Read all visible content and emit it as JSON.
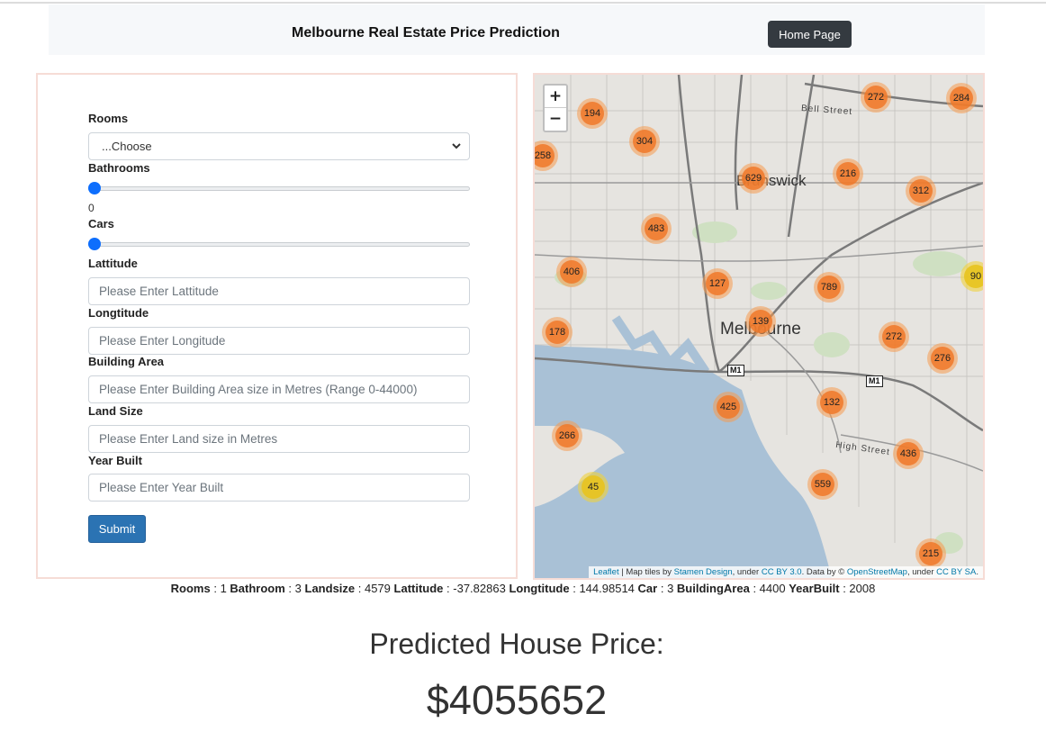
{
  "header": {
    "title": "Melbourne Real Estate Price Prediction",
    "home_button": "Home Page"
  },
  "form": {
    "rooms": {
      "label": "Rooms",
      "selected": "...Choose"
    },
    "bathrooms": {
      "label": "Bathrooms",
      "value": "0"
    },
    "cars": {
      "label": "Cars"
    },
    "latitude": {
      "label": "Lattitude",
      "placeholder": "Please Enter Lattitude"
    },
    "longitude": {
      "label": "Longtitude",
      "placeholder": "Please Enter Longitude"
    },
    "building_area": {
      "label": "Building Area",
      "placeholder": "Please Enter Building Area size in Metres  (Range 0-44000)"
    },
    "land_size": {
      "label": "Land Size",
      "placeholder": "Please Enter Land size in Metres"
    },
    "year_built": {
      "label": "Year Built",
      "placeholder": "Please Enter Year Built"
    },
    "submit": "Submit"
  },
  "map": {
    "zoom_in": "+",
    "zoom_out": "−",
    "place_labels": {
      "brunswick": "Brunswick",
      "melbourne": "Melbourne",
      "bell_street": "Bell Street",
      "high_street": "High Street"
    },
    "road_shields": {
      "m1_west": "M1",
      "m1_east": "M1"
    },
    "clusters": [
      {
        "count": "194",
        "color": "orange"
      },
      {
        "count": "304",
        "color": "orange"
      },
      {
        "count": "258",
        "color": "orange"
      },
      {
        "count": "272",
        "color": "orange"
      },
      {
        "count": "284",
        "color": "orange"
      },
      {
        "count": "629",
        "color": "orange"
      },
      {
        "count": "216",
        "color": "orange"
      },
      {
        "count": "312",
        "color": "orange"
      },
      {
        "count": "483",
        "color": "orange"
      },
      {
        "count": "406",
        "color": "orange"
      },
      {
        "count": "127",
        "color": "orange"
      },
      {
        "count": "789",
        "color": "orange"
      },
      {
        "count": "90",
        "color": "yellow"
      },
      {
        "count": "139",
        "color": "orange"
      },
      {
        "count": "178",
        "color": "orange"
      },
      {
        "count": "272",
        "color": "orange"
      },
      {
        "count": "276",
        "color": "orange"
      },
      {
        "count": "425",
        "color": "orange"
      },
      {
        "count": "132",
        "color": "orange"
      },
      {
        "count": "266",
        "color": "orange"
      },
      {
        "count": "436",
        "color": "orange"
      },
      {
        "count": "45",
        "color": "yellow"
      },
      {
        "count": "559",
        "color": "orange"
      },
      {
        "count": "215",
        "color": "orange"
      }
    ],
    "attribution": {
      "leaflet": "Leaflet",
      "t1": " | Map tiles by ",
      "stamen": "Stamen Design",
      "t2": ", under ",
      "ccby": "CC BY 3.0",
      "t3": ". Data by © ",
      "osm": "OpenStreetMap",
      "t4": ", under ",
      "ccbysa": "CC BY SA",
      "t5": "."
    }
  },
  "summary": {
    "rooms_label": "Rooms",
    "rooms_value": "1",
    "bathroom_label": "Bathroom",
    "bathroom_value": "3",
    "landsize_label": "Landsize",
    "landsize_value": "4579",
    "lattitude_label": "Lattitude",
    "lattitude_value": "-37.82863",
    "longtitude_label": "Longtitude",
    "longtitude_value": "144.98514",
    "car_label": "Car",
    "car_value": "3",
    "buildingarea_label": "BuildingArea",
    "buildingarea_value": "4400",
    "yearbuilt_label": "YearBuilt",
    "yearbuilt_value": "2008"
  },
  "prediction": {
    "label": "Predicted House Price:",
    "value": "$4055652"
  },
  "colors": {
    "home_button": "#343a40",
    "submit_button": "#2b73b3",
    "slider_thumb": "#0d6efd",
    "panel_border": "#f6dcd6",
    "cluster_orange": "#f07828",
    "cluster_yellow": "#e8c31e",
    "water": "#a9c1d6"
  }
}
